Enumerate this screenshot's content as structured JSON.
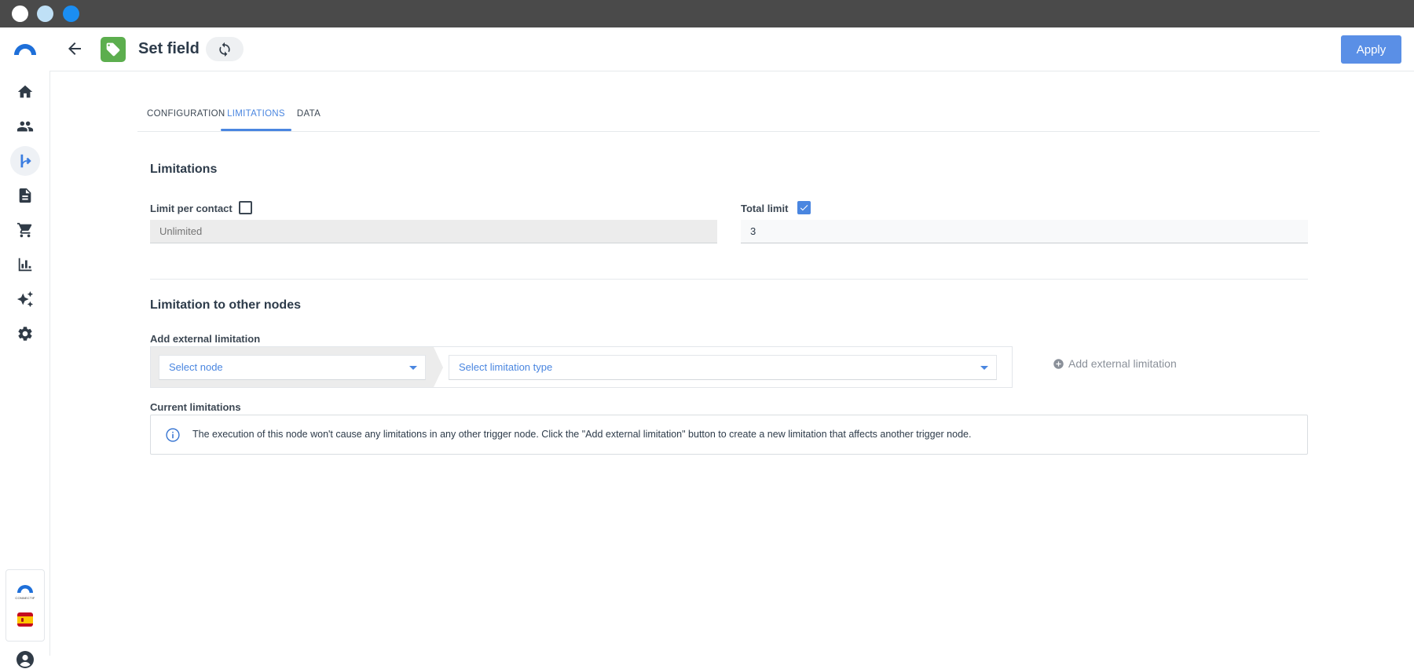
{
  "window": {
    "controls": [
      "close",
      "minimize",
      "maximize"
    ]
  },
  "sidebar": {
    "items": [
      {
        "name": "home",
        "icon": "home-icon",
        "active": false
      },
      {
        "name": "contacts",
        "icon": "people-icon",
        "active": false
      },
      {
        "name": "flows",
        "icon": "flow-branch-icon",
        "active": true
      },
      {
        "name": "documents",
        "icon": "document-icon",
        "active": false
      },
      {
        "name": "commerce",
        "icon": "cart-icon",
        "active": false
      },
      {
        "name": "analytics",
        "icon": "bar-chart-icon",
        "active": false
      },
      {
        "name": "ai",
        "icon": "sparkles-icon",
        "active": false
      },
      {
        "name": "settings",
        "icon": "gear-icon",
        "active": false
      }
    ],
    "brand_text": "CONNECTIF",
    "language_flag": "es",
    "accent_color": "#3b7de0"
  },
  "header": {
    "title": "Set field",
    "node_icon": "tag-icon",
    "node_color": "#5cae4e",
    "apply_label": "Apply",
    "apply_color": "#5a8fe6"
  },
  "tabs": [
    {
      "label": "CONFIGURATION",
      "active": false
    },
    {
      "label": "LIMITATIONS",
      "active": true
    },
    {
      "label": "DATA",
      "active": false
    }
  ],
  "limitations": {
    "title": "Limitations",
    "per_contact": {
      "label": "Limit per contact",
      "checked": false,
      "value": "Unlimited"
    },
    "total": {
      "label": "Total limit",
      "checked": true,
      "value": "3"
    }
  },
  "other_nodes": {
    "title": "Limitation to other nodes",
    "add_label": "Add external limitation",
    "select_node_placeholder": "Select node",
    "select_type_placeholder": "Select limitation type",
    "add_button_label": "Add external limitation",
    "current_label": "Current limitations",
    "info_text": "The execution of this node won't cause any limitations in any other trigger node. Click the \"Add external limitation\" button to create a new limitation that affects another trigger node."
  }
}
